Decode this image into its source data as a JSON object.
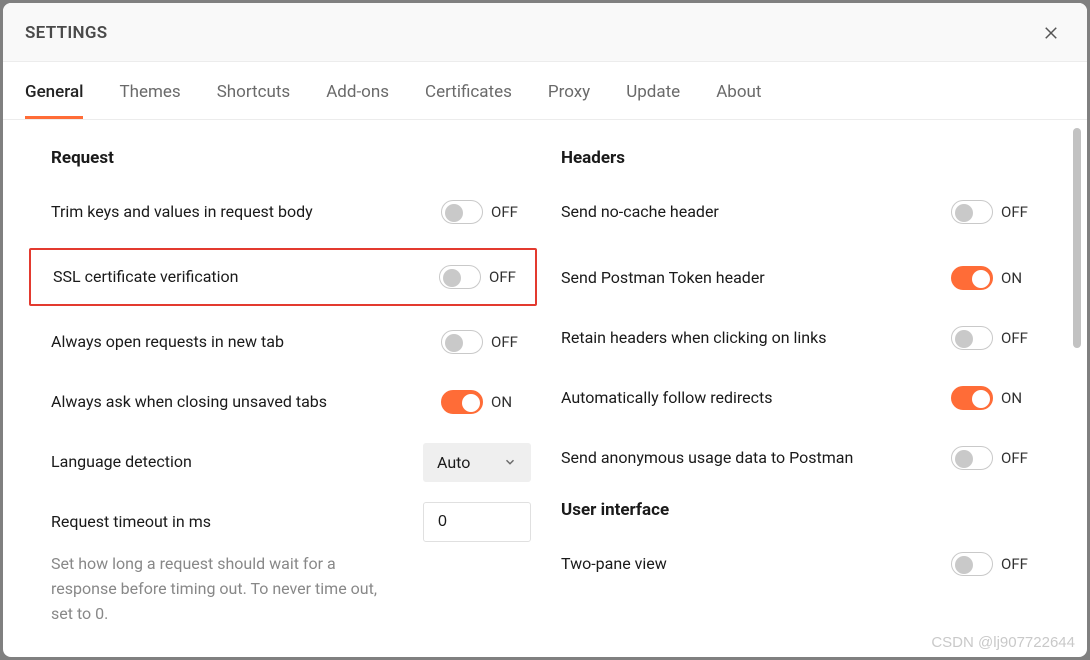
{
  "modal": {
    "title": "SETTINGS"
  },
  "tabs": [
    {
      "label": "General",
      "active": true
    },
    {
      "label": "Themes"
    },
    {
      "label": "Shortcuts"
    },
    {
      "label": "Add-ons"
    },
    {
      "label": "Certificates"
    },
    {
      "label": "Proxy"
    },
    {
      "label": "Update"
    },
    {
      "label": "About"
    }
  ],
  "toggle_labels": {
    "on": "ON",
    "off": "OFF"
  },
  "request": {
    "title": "Request",
    "trim": {
      "label": "Trim keys and values in request body",
      "value": false
    },
    "ssl": {
      "label": "SSL certificate verification",
      "value": false
    },
    "new_tab": {
      "label": "Always open requests in new tab",
      "value": false
    },
    "ask_close": {
      "label": "Always ask when closing unsaved tabs",
      "value": true
    },
    "language": {
      "label": "Language detection",
      "value": "Auto"
    },
    "timeout": {
      "label": "Request timeout in ms",
      "value": "0",
      "help": "Set how long a request should wait for a response before timing out. To never time out, set to 0."
    }
  },
  "headers": {
    "title": "Headers",
    "no_cache": {
      "label": "Send no-cache header",
      "value": false
    },
    "postman_token": {
      "label": "Send Postman Token header",
      "value": true
    },
    "retain": {
      "label": "Retain headers when clicking on links",
      "value": false
    },
    "redirects": {
      "label": "Automatically follow redirects",
      "value": true
    },
    "usage": {
      "label": "Send anonymous usage data to Postman",
      "value": false
    }
  },
  "ui": {
    "title": "User interface",
    "two_pane": {
      "label": "Two-pane view",
      "value": false
    }
  },
  "watermark": "CSDN @lj907722644"
}
